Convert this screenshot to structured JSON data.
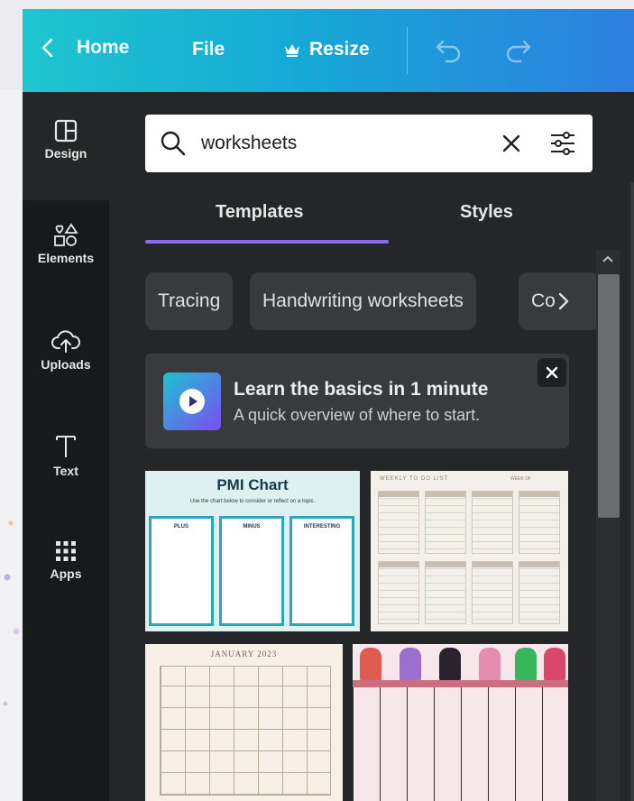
{
  "topbar": {
    "home_label": "Home",
    "file_label": "File",
    "resize_label": "Resize",
    "undo_icon": "undo-icon",
    "redo_icon": "redo-icon",
    "gradient": [
      "#1ec5cf",
      "#2d7fe0"
    ]
  },
  "sidebar": {
    "items": [
      {
        "label": "Design",
        "icon": "layout-icon",
        "active": true
      },
      {
        "label": "Elements",
        "icon": "shapes-icon"
      },
      {
        "label": "Uploads",
        "icon": "cloud-upload-icon"
      },
      {
        "label": "Text",
        "icon": "text-icon"
      },
      {
        "label": "Apps",
        "icon": "apps-grid-icon"
      }
    ]
  },
  "search": {
    "value": "worksheets",
    "icon": "search-icon",
    "clear_icon": "close-icon",
    "filter_icon": "filter-sliders-icon"
  },
  "tabs": {
    "items": [
      {
        "label": "Templates",
        "active": true
      },
      {
        "label": "Styles"
      }
    ],
    "accent": "#8b6cf0"
  },
  "chips": {
    "items": [
      "Tracing",
      "Handwriting worksheets",
      "Co"
    ],
    "next_icon": "chevron-right-icon"
  },
  "promo": {
    "title": "Learn the basics in 1 minute",
    "subtitle": "A quick overview of where to start.",
    "icon": "play-icon",
    "close_icon": "close-icon"
  },
  "templates": {
    "pmi": {
      "title": "PMI Chart",
      "subtitle": "Use the chart below to consider or reflect on a topic.",
      "columns": [
        "PLUS",
        "MINUS",
        "INTERESTING"
      ]
    },
    "todo": {
      "title": "WEEKLY TO DO LIST",
      "week_label": "WEEK OF"
    },
    "calendar": {
      "title": "JANUARY 2023"
    },
    "planner": {}
  }
}
